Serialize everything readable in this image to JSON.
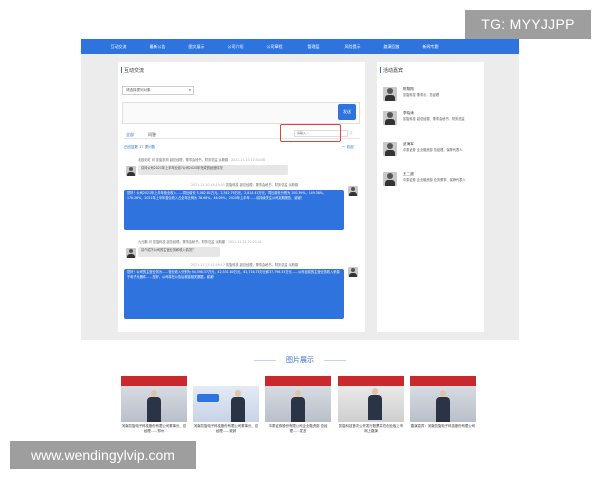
{
  "overlays": {
    "tg": "TG: MYYJJPP",
    "site": "www.wendingylvip.com"
  },
  "nav": {
    "items": [
      "互动交流",
      "最新公告",
      "图文展示",
      "公司介绍",
      "公司章程",
      "管理层",
      "风险提示",
      "路演回放",
      "新闻专题"
    ]
  },
  "interaction": {
    "title": "互动交流",
    "select_value": "请选择提问对象",
    "input_value": "",
    "send_label": "发送",
    "tabs": {
      "all": "全部",
      "ask": "问答"
    },
    "search_placeholder": "请输入...",
    "status_text": "已回复数 17  提问数",
    "collapse_text": "一 收起"
  },
  "messages": [
    {
      "meta_name": "北极彩虹 问 凯旋机构 副总经理，董事会秘书，财务总监 派斯媒",
      "time": "2021-11-10 12:54:08",
      "text": "请问公司2021年上半年业绩?公司2020年完成的经营情况",
      "side": "left",
      "style": "gray"
    },
    {
      "meta_name": "凯旋科技 副总经理，董事会秘书，财务总监 派斯媒",
      "time": "2021-11-10 14:10:55",
      "text": "您好！公司2021年上半年营业收入……同比增长 5,082.81万元，2,342.79万元，2,814.41万元，同比增长分别为 100.39%，149.38%，176.26%，2021年上半年营业收入占全年比例为 78.68%，46.09%，2020年上半年……请持续关注公司定期报告，谢谢！",
      "side": "right",
      "style": "blue"
    },
    {
      "meta_name": "九元鹏 问 凯旋科技 副总经理，董事会秘书，财务总监 派斯媒",
      "time": "2021-11-15 10:20:41",
      "text": "请介绍下公司的主营业务和收入情况？",
      "side": "left",
      "style": "gray"
    },
    {
      "meta_name": "凯旋科技 副总经理，董事会秘书，财务总监 派斯媒",
      "time": "2021-11-15 11:48:17",
      "text": "您好！公司的主营业务为……营业收入分别为 94,598.37万元，42,531.80万元，61,716.75万元和37,796.33万元……公司目前的主营业务收入来源于电子元器件……您好，公司将在公告后披露相关数据，谢谢！",
      "side": "right",
      "style": "blue"
    }
  ],
  "management": {
    "title": "活动嘉宾",
    "people": [
      {
        "name": "陈翔翔",
        "title": "凯旋科技 董事长、总经理"
      },
      {
        "name": "李晓涛",
        "title": "凯旋科技 副总经理、董事会秘书、财务总监"
      },
      {
        "name": "武海军",
        "title": "中泰证券 企业融资部 总经理、保荐代表人"
      },
      {
        "name": "王二超",
        "title": "中泰证券 企业融资部 业务董事、保荐代表人"
      }
    ]
  },
  "gallery": {
    "title": "图片展示",
    "items": [
      {
        "caption": "河南凯旋电子科技股份有限公司董事长、总经理……郑州"
      },
      {
        "caption": "河南凯旋电子科技股份有限公司董事长、总经理……致辞"
      },
      {
        "caption": "中泰证券股份有限公司企业融资部 总经理……发言"
      },
      {
        "caption": "凯旋科技首次公开发行股票并在创业板上市网上路演"
      },
      {
        "caption": "路演嘉宾：河南凯旋电子科技股份有限公司"
      }
    ]
  }
}
